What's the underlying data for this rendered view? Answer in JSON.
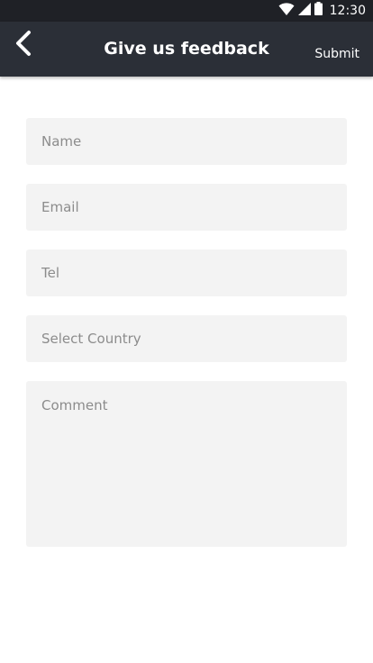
{
  "status_bar": {
    "time": "12:30",
    "icons": [
      "wifi-icon",
      "cellular-signal-icon",
      "battery-icon"
    ]
  },
  "app_bar": {
    "back_icon": "chevron-left-icon",
    "title": "Give us feedback",
    "submit_label": "Submit"
  },
  "form": {
    "name_placeholder": "Name",
    "email_placeholder": "Email",
    "tel_placeholder": "Tel",
    "country_placeholder": "Select Country",
    "comment_placeholder": "Comment"
  },
  "colors": {
    "status_bar": "#1f2126",
    "app_bar": "#2b2f37",
    "field_background": "#f3f3f3",
    "placeholder_text": "#8c8c8c"
  }
}
